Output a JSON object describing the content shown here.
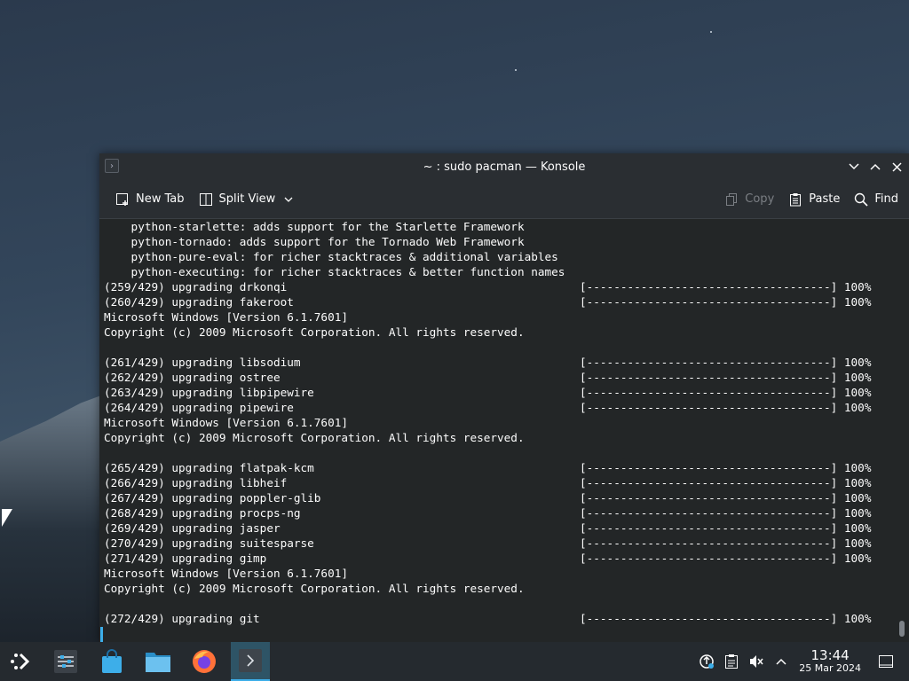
{
  "window": {
    "title": "~ : sudo pacman — Konsole",
    "controls": {
      "minimize": "⌄",
      "maximize": "⌃",
      "close": "✕"
    }
  },
  "toolbar": {
    "new_tab": "New Tab",
    "split_view": "Split View",
    "copy": "Copy",
    "paste": "Paste",
    "find": "Find"
  },
  "terminal": {
    "lines": [
      {
        "text": "    python-starlette: adds support for the Starlette Framework",
        "bar": ""
      },
      {
        "text": "    python-tornado: adds support for the Tornado Web Framework",
        "bar": ""
      },
      {
        "text": "    python-pure-eval: for richer stacktraces & additional variables",
        "bar": ""
      },
      {
        "text": "    python-executing: for richer stacktraces & better function names",
        "bar": ""
      },
      {
        "text": "(259/429) upgrading drkonqi",
        "bar": "[------------------------------------] 100%"
      },
      {
        "text": "(260/429) upgrading fakeroot",
        "bar": "[------------------------------------] 100%"
      },
      {
        "text": "Microsoft Windows [Version 6.1.7601]",
        "bar": ""
      },
      {
        "text": "Copyright (c) 2009 Microsoft Corporation. All rights reserved.",
        "bar": ""
      },
      {
        "text": "",
        "bar": ""
      },
      {
        "text": "(261/429) upgrading libsodium",
        "bar": "[------------------------------------] 100%"
      },
      {
        "text": "(262/429) upgrading ostree",
        "bar": "[------------------------------------] 100%"
      },
      {
        "text": "(263/429) upgrading libpipewire",
        "bar": "[------------------------------------] 100%"
      },
      {
        "text": "(264/429) upgrading pipewire",
        "bar": "[------------------------------------] 100%"
      },
      {
        "text": "Microsoft Windows [Version 6.1.7601]",
        "bar": ""
      },
      {
        "text": "Copyright (c) 2009 Microsoft Corporation. All rights reserved.",
        "bar": ""
      },
      {
        "text": "",
        "bar": ""
      },
      {
        "text": "(265/429) upgrading flatpak-kcm",
        "bar": "[------------------------------------] 100%"
      },
      {
        "text": "(266/429) upgrading libheif",
        "bar": "[------------------------------------] 100%"
      },
      {
        "text": "(267/429) upgrading poppler-glib",
        "bar": "[------------------------------------] 100%"
      },
      {
        "text": "(268/429) upgrading procps-ng",
        "bar": "[------------------------------------] 100%"
      },
      {
        "text": "(269/429) upgrading jasper",
        "bar": "[------------------------------------] 100%"
      },
      {
        "text": "(270/429) upgrading suitesparse",
        "bar": "[------------------------------------] 100%"
      },
      {
        "text": "(271/429) upgrading gimp",
        "bar": "[------------------------------------] 100%"
      },
      {
        "text": "Microsoft Windows [Version 6.1.7601]",
        "bar": ""
      },
      {
        "text": "Copyright (c) 2009 Microsoft Corporation. All rights reserved.",
        "bar": ""
      },
      {
        "text": "",
        "bar": ""
      },
      {
        "text": "(272/429) upgrading git",
        "bar": "[------------------------------------] 100%"
      }
    ]
  },
  "taskbar": {
    "apps": [
      {
        "name": "application-launcher",
        "icon": "kde-launcher-icon",
        "active": false
      },
      {
        "name": "system-settings",
        "icon": "settings-sliders-icon",
        "active": false
      },
      {
        "name": "discover",
        "icon": "store-bag-icon",
        "active": false
      },
      {
        "name": "dolphin",
        "icon": "folder-icon",
        "active": false
      },
      {
        "name": "firefox",
        "icon": "firefox-icon",
        "active": false
      },
      {
        "name": "konsole",
        "icon": "terminal-icon",
        "active": true
      }
    ],
    "clock": {
      "time": "13:44",
      "date": "25 Mar 2024"
    }
  },
  "colors": {
    "accent": "#3daee9",
    "terminal_bg": "#232627",
    "panel_bg": "#252a2f"
  }
}
